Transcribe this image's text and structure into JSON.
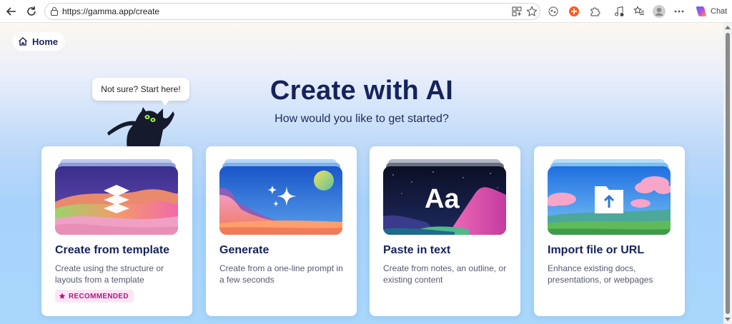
{
  "browser": {
    "url": "https://gamma.app/create",
    "chat_label": "Chat"
  },
  "home": {
    "label": "Home"
  },
  "hero": {
    "title": "Create with AI",
    "subtitle": "How would you like to get started?",
    "bubble": "Not sure? Start here!"
  },
  "cards": [
    {
      "title": "Create from template",
      "description": "Create using the structure or layouts from a template",
      "badge": "RECOMMENDED"
    },
    {
      "title": "Generate",
      "description": "Create from a one-line prompt in a few seconds"
    },
    {
      "title": "Paste in text",
      "description": "Create from notes, an outline, or existing content",
      "art_text": "Aa"
    },
    {
      "title": "Import file or URL",
      "description": "Enhance existing docs, presentations, or webpages"
    }
  ],
  "colors": {
    "accent": "#16235b",
    "badge": "#b0197f"
  }
}
